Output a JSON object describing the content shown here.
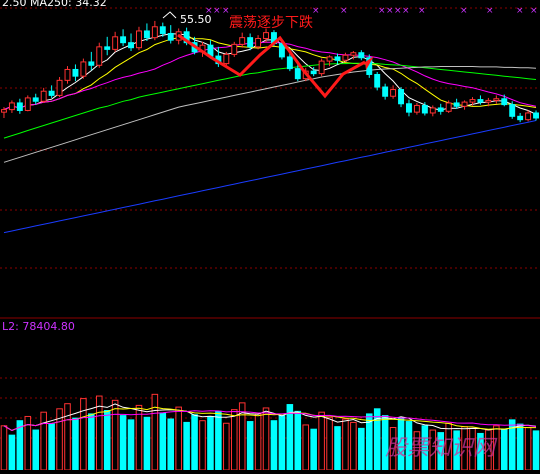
{
  "header": {
    "price_ma_partial": "2.50",
    "ma_label": "MA250: 34.32"
  },
  "annotations": {
    "peak_price": "55.50",
    "pattern_text": "震荡逐步下跌",
    "watermark": "股票知识网"
  },
  "volume_panel": {
    "label": "L2: 78404.80"
  },
  "colors": {
    "background": "#000000",
    "up": "#ff3232",
    "down": "#00ffff",
    "ma5": "#ffffff",
    "ma10": "#ffff00",
    "ma20": "#ff00ff",
    "ma60": "#00ff00",
    "ma120": "#c0c0c0",
    "ma250": "#1a3cff",
    "grid": "#8b0000",
    "arrow": "#ff1a1a",
    "marker": "#cc33ff"
  },
  "chart_data": {
    "type": "candlestick",
    "candles": [
      [
        44.6,
        45.2,
        43.9,
        44.9
      ],
      [
        44.9,
        46.0,
        44.5,
        45.7
      ],
      [
        45.7,
        46.2,
        44.4,
        44.8
      ],
      [
        44.8,
        46.6,
        44.7,
        46.3
      ],
      [
        46.3,
        46.8,
        45.5,
        45.9
      ],
      [
        45.9,
        47.5,
        45.7,
        47.1
      ],
      [
        47.1,
        47.8,
        46.3,
        46.6
      ],
      [
        46.6,
        48.8,
        46.4,
        48.4
      ],
      [
        48.4,
        50.1,
        48.0,
        49.7
      ],
      [
        49.7,
        50.3,
        48.3,
        48.9
      ],
      [
        48.9,
        51.0,
        48.6,
        50.6
      ],
      [
        50.6,
        51.8,
        49.6,
        50.2
      ],
      [
        50.2,
        52.9,
        49.9,
        52.4
      ],
      [
        52.4,
        53.6,
        51.4,
        52.1
      ],
      [
        52.1,
        54.2,
        51.8,
        53.6
      ],
      [
        53.6,
        54.5,
        52.5,
        52.9
      ],
      [
        52.9,
        54.0,
        51.9,
        52.3
      ],
      [
        52.3,
        54.8,
        52.0,
        54.3
      ],
      [
        54.3,
        55.2,
        53.1,
        53.5
      ],
      [
        53.5,
        55.5,
        53.2,
        54.8
      ],
      [
        54.8,
        55.3,
        53.6,
        54.0
      ],
      [
        54.0,
        55.0,
        52.8,
        53.2
      ],
      [
        53.2,
        54.6,
        52.7,
        54.2
      ],
      [
        54.2,
        54.7,
        52.6,
        52.9
      ],
      [
        52.9,
        53.6,
        51.5,
        51.8
      ],
      [
        51.8,
        53.0,
        51.2,
        52.6
      ],
      [
        52.6,
        53.2,
        51.0,
        51.3
      ],
      [
        51.3,
        52.4,
        50.0,
        50.4
      ],
      [
        50.4,
        51.8,
        50.1,
        51.5
      ],
      [
        51.5,
        53.0,
        51.2,
        52.7
      ],
      [
        52.7,
        54.1,
        52.3,
        53.5
      ],
      [
        53.5,
        54.0,
        52.0,
        52.4
      ],
      [
        52.4,
        53.8,
        52.1,
        53.4
      ],
      [
        53.4,
        54.6,
        52.9,
        54.1
      ],
      [
        54.1,
        54.4,
        52.5,
        52.8
      ],
      [
        52.8,
        53.0,
        50.9,
        51.2
      ],
      [
        51.2,
        51.8,
        49.5,
        49.8
      ],
      [
        49.8,
        50.4,
        48.3,
        48.6
      ],
      [
        48.6,
        49.9,
        48.3,
        49.5
      ],
      [
        49.5,
        50.0,
        48.9,
        49.2
      ],
      [
        49.2,
        51.0,
        48.9,
        50.7
      ],
      [
        50.7,
        51.4,
        50.1,
        51.2
      ],
      [
        51.2,
        51.6,
        50.3,
        50.8
      ],
      [
        50.8,
        51.7,
        50.6,
        51.4
      ],
      [
        51.4,
        51.9,
        50.9,
        51.7
      ],
      [
        51.7,
        52.0,
        50.8,
        51.1
      ],
      [
        51.1,
        51.5,
        48.7,
        49.1
      ],
      [
        49.1,
        49.4,
        47.2,
        47.6
      ],
      [
        47.6,
        48.0,
        46.1,
        46.5
      ],
      [
        46.5,
        47.8,
        46.2,
        47.3
      ],
      [
        47.3,
        47.6,
        45.2,
        45.6
      ],
      [
        45.6,
        46.1,
        44.1,
        44.6
      ],
      [
        44.6,
        45.7,
        44.3,
        45.4
      ],
      [
        45.4,
        45.8,
        44.2,
        44.5
      ],
      [
        44.5,
        45.4,
        44.1,
        45.1
      ],
      [
        45.1,
        45.6,
        44.3,
        44.7
      ],
      [
        44.7,
        46.0,
        44.5,
        45.7
      ],
      [
        45.7,
        46.2,
        45.0,
        45.3
      ],
      [
        45.3,
        46.0,
        44.9,
        45.8
      ],
      [
        45.8,
        46.4,
        45.4,
        46.1
      ],
      [
        46.1,
        46.6,
        45.5,
        45.8
      ],
      [
        45.8,
        46.3,
        45.3,
        46.0
      ],
      [
        46.0,
        46.6,
        45.6,
        46.2
      ],
      [
        46.2,
        46.7,
        45.3,
        45.5
      ],
      [
        45.5,
        45.9,
        43.8,
        44.1
      ],
      [
        44.1,
        44.5,
        43.4,
        43.7
      ],
      [
        43.7,
        44.8,
        43.5,
        44.5
      ],
      [
        44.5,
        44.8,
        43.6,
        43.9
      ]
    ],
    "volume": [
      [
        52,
        "up"
      ],
      [
        41,
        "down"
      ],
      [
        58,
        "down"
      ],
      [
        63,
        "up"
      ],
      [
        47,
        "down"
      ],
      [
        68,
        "up"
      ],
      [
        54,
        "down"
      ],
      [
        72,
        "up"
      ],
      [
        78,
        "up"
      ],
      [
        61,
        "down"
      ],
      [
        84,
        "up"
      ],
      [
        66,
        "down"
      ],
      [
        87,
        "up"
      ],
      [
        70,
        "down"
      ],
      [
        82,
        "up"
      ],
      [
        64,
        "down"
      ],
      [
        59,
        "down"
      ],
      [
        76,
        "up"
      ],
      [
        62,
        "down"
      ],
      [
        89,
        "up"
      ],
      [
        67,
        "down"
      ],
      [
        60,
        "down"
      ],
      [
        74,
        "up"
      ],
      [
        56,
        "down"
      ],
      [
        65,
        "down"
      ],
      [
        58,
        "up"
      ],
      [
        63,
        "down"
      ],
      [
        69,
        "down"
      ],
      [
        55,
        "up"
      ],
      [
        71,
        "up"
      ],
      [
        79,
        "up"
      ],
      [
        57,
        "down"
      ],
      [
        66,
        "up"
      ],
      [
        73,
        "up"
      ],
      [
        58,
        "down"
      ],
      [
        64,
        "down"
      ],
      [
        77,
        "down"
      ],
      [
        69,
        "down"
      ],
      [
        53,
        "up"
      ],
      [
        48,
        "down"
      ],
      [
        68,
        "up"
      ],
      [
        62,
        "up"
      ],
      [
        51,
        "down"
      ],
      [
        60,
        "up"
      ],
      [
        56,
        "up"
      ],
      [
        49,
        "down"
      ],
      [
        66,
        "down"
      ],
      [
        72,
        "down"
      ],
      [
        64,
        "down"
      ],
      [
        50,
        "up"
      ],
      [
        61,
        "down"
      ],
      [
        57,
        "down"
      ],
      [
        45,
        "up"
      ],
      [
        52,
        "down"
      ],
      [
        47,
        "up"
      ],
      [
        44,
        "down"
      ],
      [
        55,
        "up"
      ],
      [
        46,
        "down"
      ],
      [
        51,
        "up"
      ],
      [
        49,
        "up"
      ],
      [
        43,
        "down"
      ],
      [
        47,
        "up"
      ],
      [
        52,
        "up"
      ],
      [
        48,
        "down"
      ],
      [
        59,
        "down"
      ],
      [
        54,
        "down"
      ],
      [
        50,
        "up"
      ],
      [
        46,
        "down"
      ]
    ],
    "moving_averages": [
      {
        "key": "ma60",
        "values": [
          41.5,
          41.8,
          42.1,
          42.4,
          42.7,
          43.0,
          43.3,
          43.6,
          43.9,
          44.2,
          44.5,
          44.8,
          45.1,
          45.3,
          45.6,
          45.9,
          46.1,
          46.4,
          46.6,
          46.8,
          47.0,
          47.2,
          47.4,
          47.6,
          47.8,
          48.0,
          48.2,
          48.4,
          48.6,
          48.8,
          49.0,
          49.2,
          49.3,
          49.5,
          49.7,
          49.8,
          49.9,
          50.0,
          50.1,
          50.2,
          50.3,
          50.35,
          50.4,
          50.4,
          50.45,
          50.45,
          50.4,
          50.4,
          50.3,
          50.25,
          50.2,
          50.1,
          50.0,
          49.9,
          49.8,
          49.7,
          49.6,
          49.5,
          49.4,
          49.3,
          49.2,
          49.1,
          49.0,
          48.9,
          48.8,
          48.7,
          48.6,
          48.5
        ]
      },
      {
        "key": "ma120",
        "values": [
          38.6,
          38.9,
          39.2,
          39.5,
          39.8,
          40.1,
          40.4,
          40.7,
          41.0,
          41.3,
          41.6,
          41.9,
          42.2,
          42.5,
          42.8,
          43.1,
          43.4,
          43.7,
          44.0,
          44.3,
          44.6,
          44.9,
          45.2,
          45.4,
          45.6,
          45.8,
          46.0,
          46.2,
          46.4,
          46.6,
          46.8,
          47.0,
          47.2,
          47.4,
          47.6,
          47.8,
          48.0,
          48.2,
          48.4,
          48.6,
          48.8,
          48.95,
          49.1,
          49.25,
          49.4,
          49.5,
          49.6,
          49.7,
          49.75,
          49.8,
          49.85,
          49.9,
          49.95,
          50.0,
          50.0,
          50.05,
          50.05,
          50.05,
          50.05,
          50.05,
          50.0,
          50.0,
          50.0,
          49.95,
          49.95,
          49.9,
          49.9,
          49.85
        ]
      },
      {
        "key": "ma250",
        "values": [
          30.2,
          30.4,
          30.6,
          30.8,
          31.0,
          31.2,
          31.4,
          31.6,
          31.8,
          32.0,
          32.2,
          32.4,
          32.6,
          32.8,
          33.0,
          33.2,
          33.4,
          33.6,
          33.8,
          34.0,
          34.2,
          34.4,
          34.6,
          34.8,
          35.0,
          35.2,
          35.4,
          35.6,
          35.8,
          36.0,
          36.2,
          36.4,
          36.6,
          36.8,
          37.0,
          37.2,
          37.4,
          37.6,
          37.8,
          38.0,
          38.2,
          38.4,
          38.6,
          38.8,
          39.0,
          39.2,
          39.4,
          39.6,
          39.8,
          40.0,
          40.2,
          40.4,
          40.6,
          40.8,
          41.0,
          41.2,
          41.4,
          41.6,
          41.8,
          42.0,
          42.2,
          42.4,
          42.6,
          42.8,
          43.0,
          43.2,
          43.4,
          43.6
        ]
      }
    ],
    "price_range": [
      20.0,
      58.0
    ],
    "volume_max": 100
  }
}
